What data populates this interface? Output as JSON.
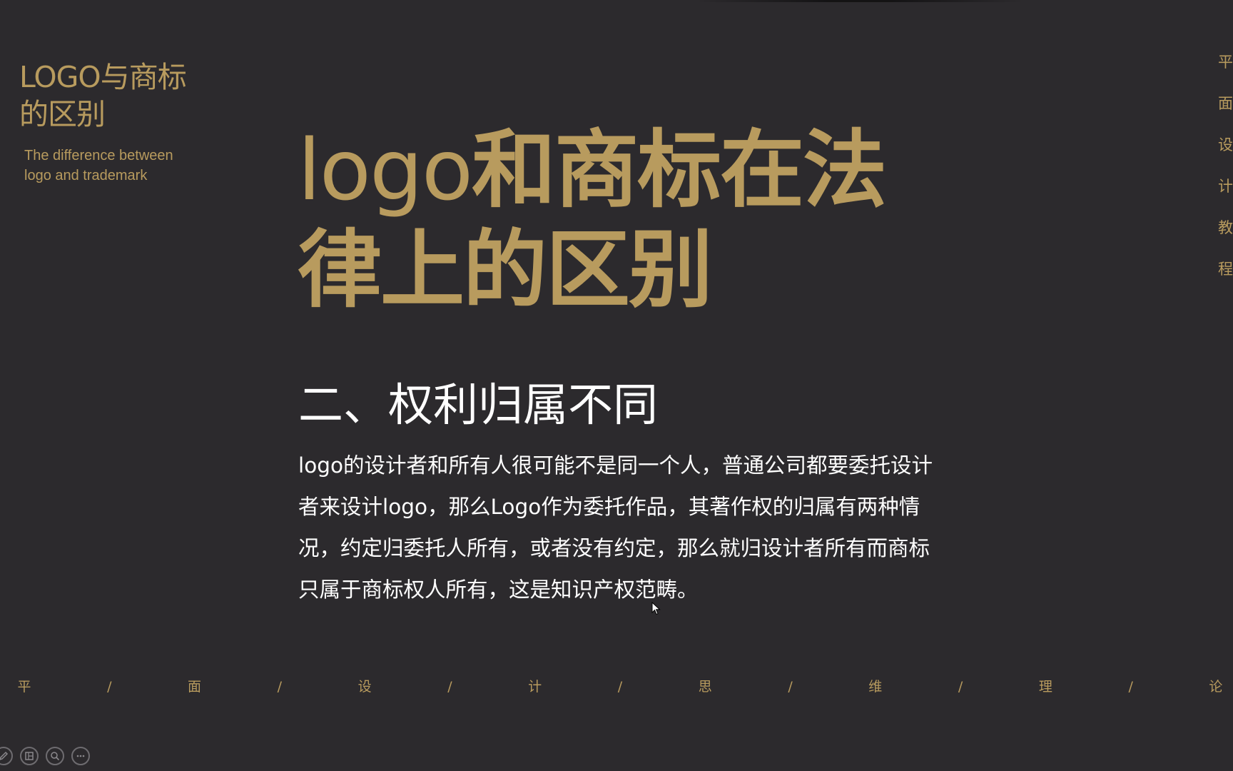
{
  "side_panel": {
    "title_line1": "LOGO与商标",
    "title_line2": "的区别",
    "subtitle_line1": "The difference between",
    "subtitle_line2": "logo and trademark"
  },
  "main": {
    "title_latin": "logo",
    "title_rest_line1": "和商标在法",
    "title_line2": "律上的区别",
    "section_heading": "二、权利归属不同",
    "body": "logo的设计者和所有人很可能不是同一个人，普通公司都要委托设计者来设计logo，那么Logo作为委托作品，其著作权的归属有两种情况，约定归委托人所有，或者没有约定，那么就归设计者所有而商标只属于商标权人所有，这是知识产权范畴。"
  },
  "vertical_nav": [
    "平",
    "面",
    "设",
    "计",
    "教",
    "程"
  ],
  "bottom_nav": [
    "平",
    "/",
    "面",
    "/",
    "设",
    "/",
    "计",
    "/",
    "思",
    "/",
    "维",
    "/",
    "理",
    "/",
    "论"
  ],
  "toolbar": {
    "icons": [
      "pen-icon",
      "slides-icon",
      "zoom-icon",
      "more-icon"
    ]
  },
  "colors": {
    "background": "#2c2a2d",
    "accent_gold": "#b89b5e",
    "text_white": "#ffffff"
  }
}
